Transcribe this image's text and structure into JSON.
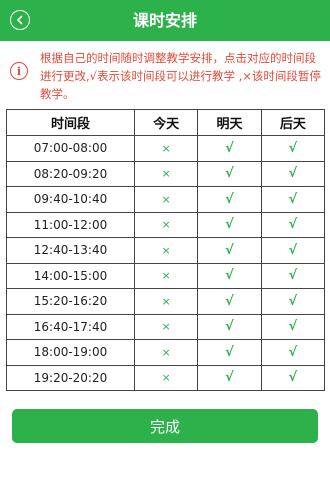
{
  "header": {
    "title": "课时安排",
    "back_icon": "chevron-left-icon"
  },
  "notice": {
    "icon": "info-icon",
    "icon_char": "i",
    "text": "根据自己的时间随时调整教学安排，点击对应的时间段进行更改,√表示该时间段可以进行教学 ,×该时间段暂停教学。"
  },
  "table": {
    "headers": [
      "时间段",
      "今天",
      "明天",
      "后天"
    ],
    "rows": [
      {
        "time": "07:00-08:00",
        "today": "×",
        "tomorrow": "√",
        "after": "√"
      },
      {
        "time": "08:20-09:20",
        "today": "×",
        "tomorrow": "√",
        "after": "√"
      },
      {
        "time": "09:40-10:40",
        "today": "×",
        "tomorrow": "√",
        "after": "√"
      },
      {
        "time": "11:00-12:00",
        "today": "×",
        "tomorrow": "√",
        "after": "√"
      },
      {
        "time": "12:40-13:40",
        "today": "×",
        "tomorrow": "√",
        "after": "√"
      },
      {
        "time": "14:00-15:00",
        "today": "×",
        "tomorrow": "√",
        "after": "√"
      },
      {
        "time": "15:20-16:20",
        "today": "×",
        "tomorrow": "√",
        "after": "√"
      },
      {
        "time": "16:40-17:40",
        "today": "×",
        "tomorrow": "√",
        "after": "√"
      },
      {
        "time": "18:00-19:00",
        "today": "×",
        "tomorrow": "√",
        "after": "√"
      },
      {
        "time": "19:20-20:20",
        "today": "×",
        "tomorrow": "√",
        "after": "√"
      }
    ]
  },
  "footer": {
    "finish_label": "完成"
  },
  "colors": {
    "accent": "#2db14b",
    "warning": "#e24b3b"
  }
}
